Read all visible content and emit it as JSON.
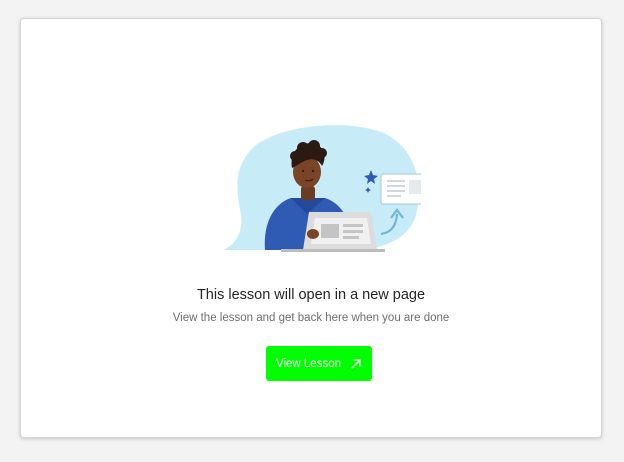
{
  "lesson_card": {
    "title": "This lesson will open in a new page",
    "subtitle": "View the lesson and get back here when you are done",
    "button_label": "View Lesson",
    "button_icon": "external-link-arrow-icon",
    "button_color": "#00ff00",
    "illustration": "person-at-laptop-illustration"
  }
}
